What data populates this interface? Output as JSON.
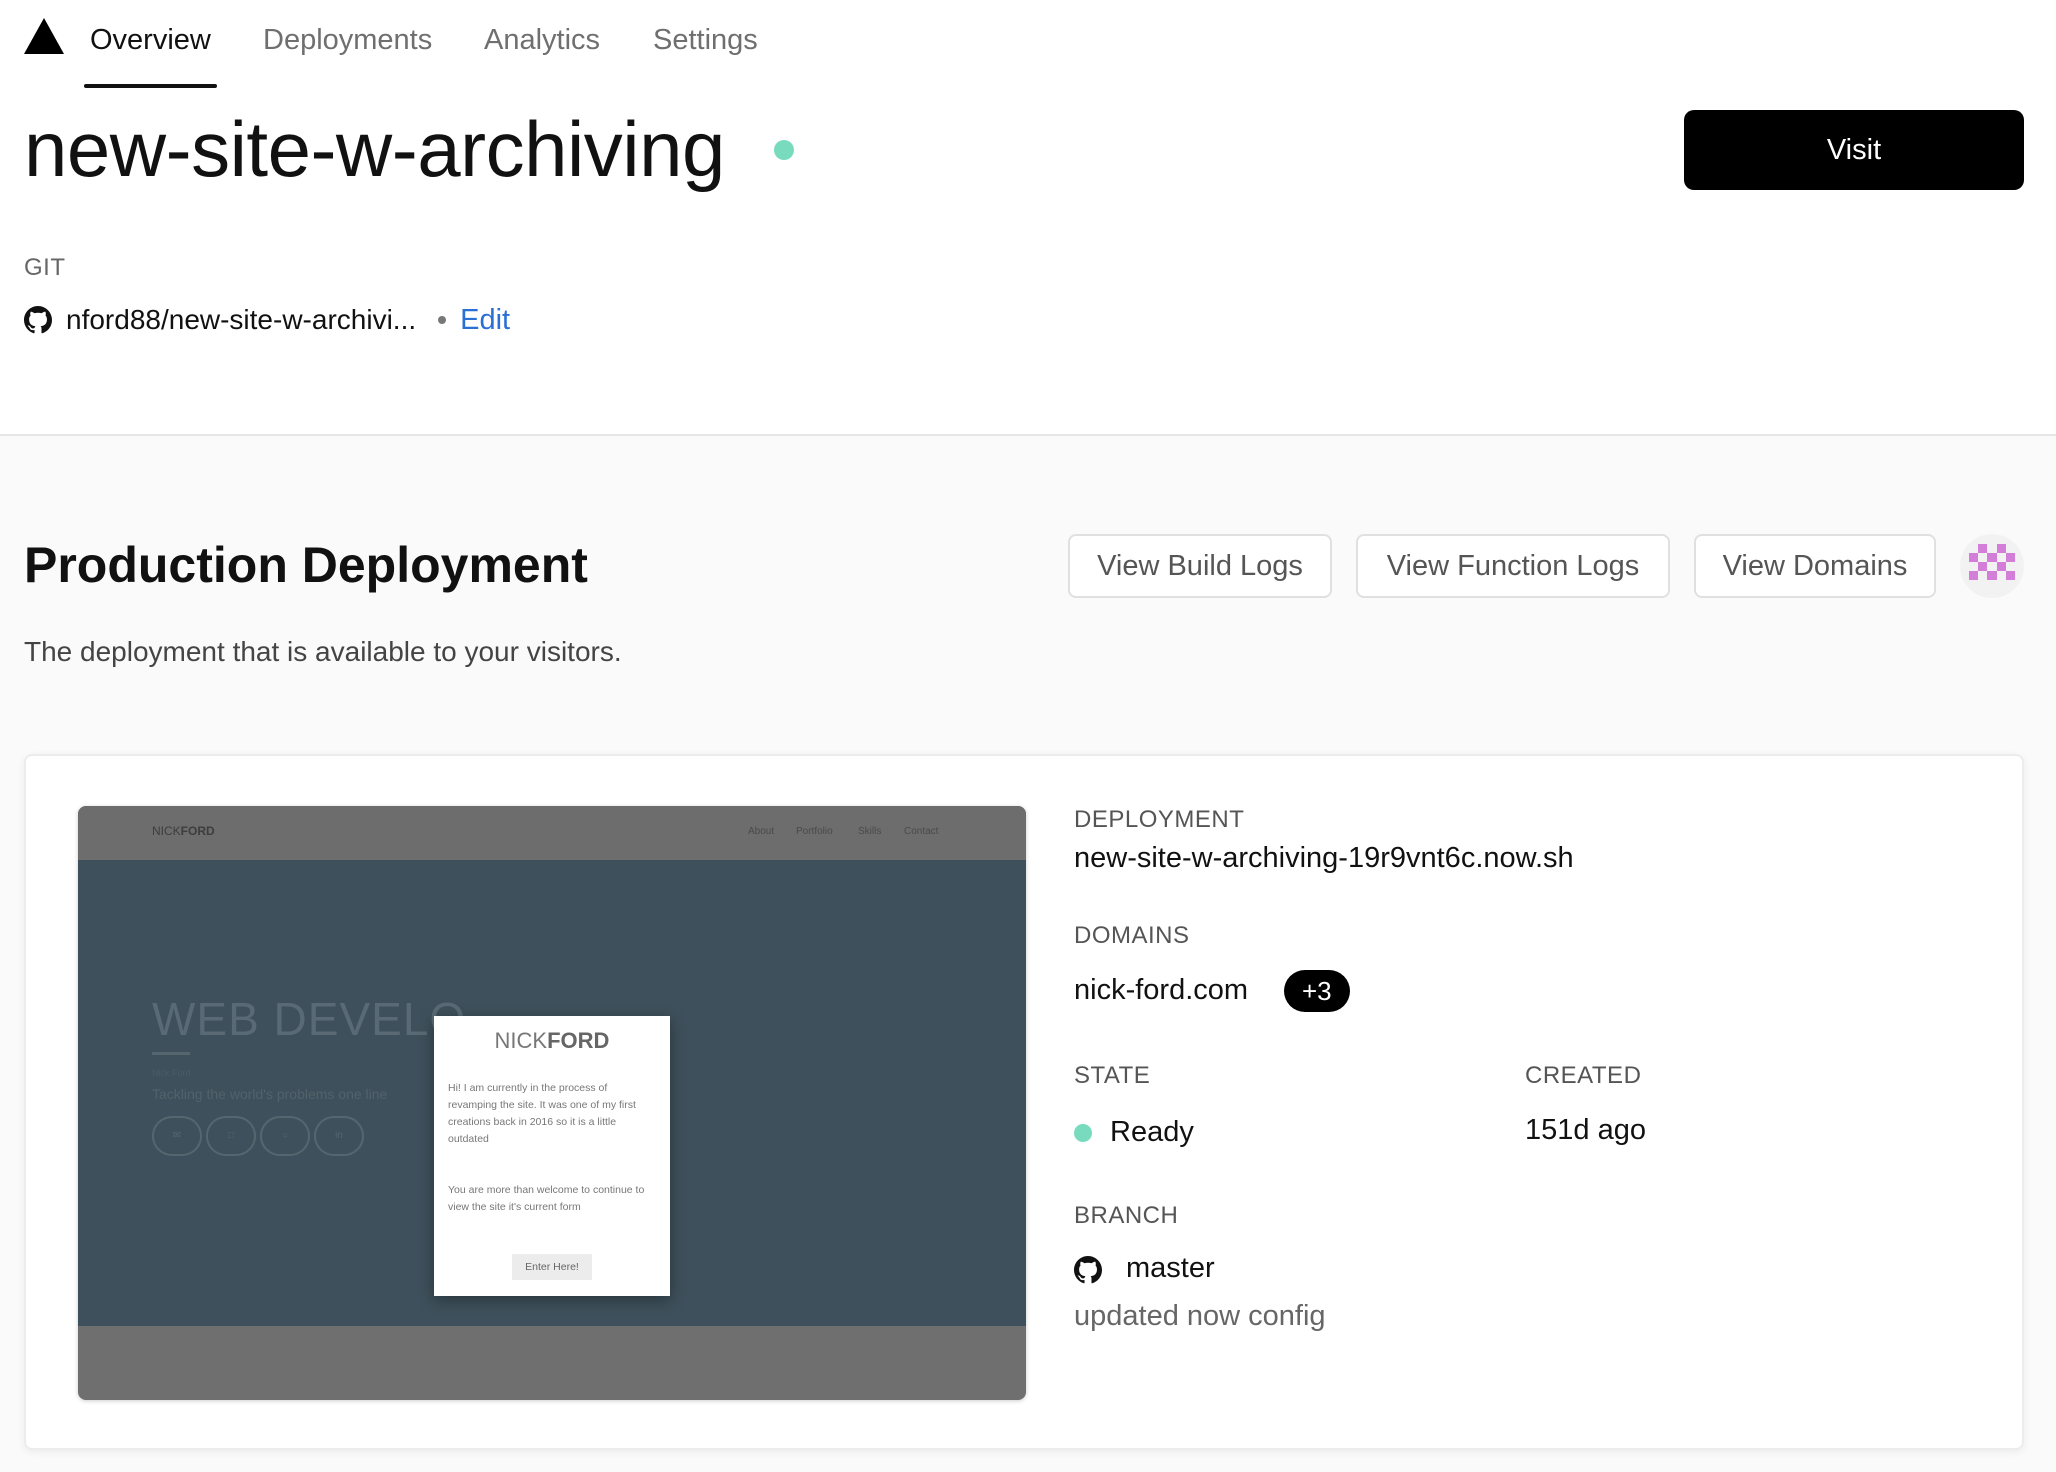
{
  "nav": {
    "tabs": [
      {
        "label": "Overview",
        "active": true
      },
      {
        "label": "Deployments"
      },
      {
        "label": "Analytics"
      },
      {
        "label": "Settings"
      }
    ]
  },
  "project": {
    "title": "new-site-w-archiving",
    "status_color": "#79dbbe",
    "visit_label": "Visit"
  },
  "git": {
    "label": "GIT",
    "repo": "nford88/new-site-w-archivi...",
    "edit_label": "Edit"
  },
  "production": {
    "title": "Production Deployment",
    "description": "The deployment that is available to your visitors.",
    "buttons": {
      "build_logs": "View Build Logs",
      "function_logs": "View Function Logs",
      "domains": "View Domains"
    }
  },
  "preview": {
    "brand_light": "NICK",
    "brand_bold": "FORD",
    "nav_links": [
      "About",
      "Portfolio",
      "Skills",
      "Contact"
    ],
    "hero_title": "WEB DEVELO",
    "hero_small": "Nick Ford",
    "hero_tagline": "Tackling the world's problems one line",
    "social_icons": [
      "✉",
      "□",
      "○",
      "in"
    ],
    "modal": {
      "title_light": "NICK",
      "title_bold": "FORD",
      "paragraph1": "Hi! I am currently in the process of revamping the site. It was one of my first creations back in 2016 so it is a little outdated",
      "paragraph2": "You are more than welcome to continue to view the site it's current form",
      "button": "Enter Here!"
    }
  },
  "deployment": {
    "deployment_label": "DEPLOYMENT",
    "deployment_url": "new-site-w-archiving-19r9vnt6c.now.sh",
    "domains_label": "DOMAINS",
    "domain": "nick-ford.com",
    "domains_extra": "+3",
    "state_label": "STATE",
    "state": "Ready",
    "state_color": "#79dbbe",
    "created_label": "CREATED",
    "created": "151d ago",
    "branch_label": "BRANCH",
    "branch": "master",
    "commit_message": "updated now config"
  }
}
